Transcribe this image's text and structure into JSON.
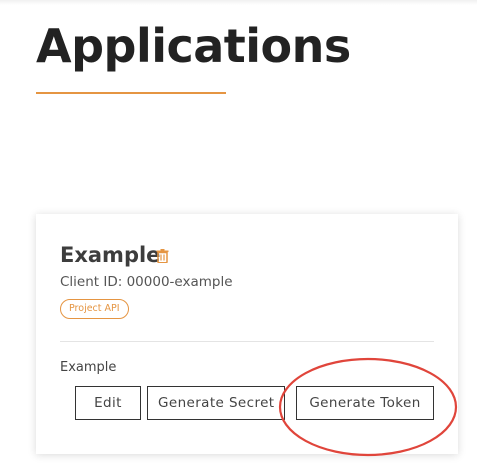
{
  "page": {
    "title": "Applications"
  },
  "application": {
    "name": "Example",
    "client_id": "Client ID: 00000-example",
    "badge": "Project API",
    "section_label": "Example",
    "buttons": {
      "edit": "Edit",
      "generate_secret": "Generate Secret",
      "generate_token": "Generate Token"
    },
    "delete_icon": "trash-icon"
  },
  "colors": {
    "accent": "#e59542",
    "highlight_circle": "#e0453b",
    "text_dark": "#222222"
  }
}
